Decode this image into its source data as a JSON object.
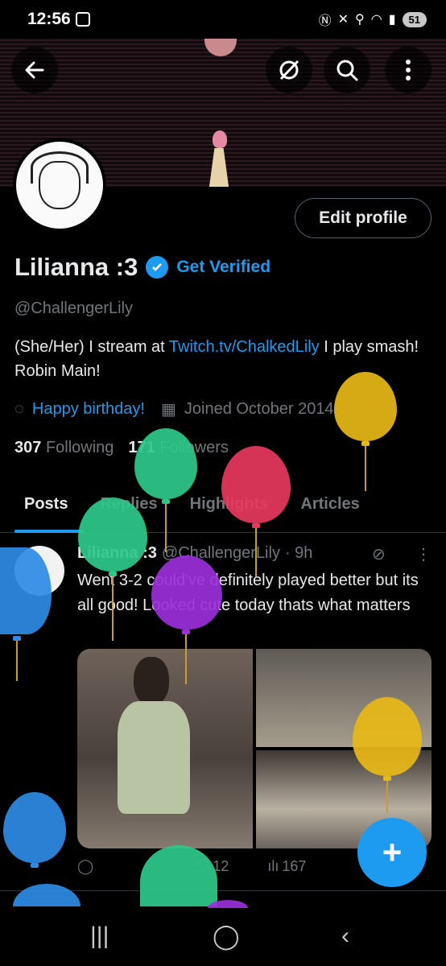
{
  "status_bar": {
    "time": "12:56",
    "battery": "51"
  },
  "profile": {
    "name": "Lilianna :3",
    "get_verified": "Get Verified",
    "handle": "@ChallengerLily",
    "bio_prefix": "(She/Her) I stream at ",
    "bio_link": "Twitch.tv/ChalkedLily",
    "bio_suffix": " I play smash! Robin Main!",
    "birthday": "Happy birthday!",
    "joined": "Joined October 2014",
    "following_count": "307",
    "following_label": "Following",
    "followers_count": "171",
    "followers_label": "Followers",
    "edit_profile": "Edit profile"
  },
  "tabs": [
    "Posts",
    "Replies",
    "Highlights",
    "Articles"
  ],
  "post": {
    "name": "Lilianna :3",
    "handle": "@ChallengerLily",
    "time": "· 9h",
    "text": "Went 3-2 could've definitely played better but its all good! Looked cute today thats what matters",
    "likes": "12",
    "views": "167"
  },
  "fab": "+",
  "colors": {
    "accent": "#1d9bf0",
    "background": "#000000",
    "muted": "#71767b"
  }
}
